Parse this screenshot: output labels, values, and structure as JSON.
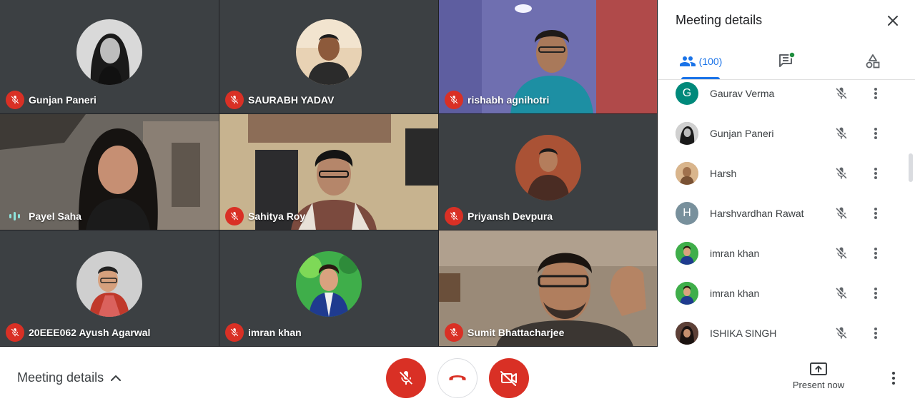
{
  "tiles": [
    {
      "name": "Gunjan Paneri",
      "mic": "muted"
    },
    {
      "name": "SAURABH YADAV",
      "mic": "muted"
    },
    {
      "name": "rishabh agnihotri",
      "mic": "muted"
    },
    {
      "name": "Payel Saha",
      "mic": "speaking"
    },
    {
      "name": "Sahitya Roy",
      "mic": "muted"
    },
    {
      "name": "Priyansh Devpura",
      "mic": "muted"
    },
    {
      "name": "20EEE062 Ayush Agarwal",
      "mic": "muted"
    },
    {
      "name": "imran khan",
      "mic": "muted"
    },
    {
      "name": "Sumit Bhattacharjee",
      "mic": "muted"
    }
  ],
  "panel": {
    "title": "Meeting details",
    "people_tab_label": "(100)",
    "chat_has_notification": true
  },
  "people": [
    {
      "name": "Gaurav Verma",
      "initial": "G",
      "avatar_color": "#00897b"
    },
    {
      "name": "Gunjan Paneri",
      "initial": "",
      "avatar_color": "#9e9e9e"
    },
    {
      "name": "Harsh",
      "initial": "",
      "avatar_color": "#c8a27a"
    },
    {
      "name": "Harshvardhan Rawat",
      "initial": "H",
      "avatar_color": "#78909c"
    },
    {
      "name": "imran khan",
      "initial": "",
      "avatar_color": "#4caf50"
    },
    {
      "name": "imran khan",
      "initial": "",
      "avatar_color": "#4caf50"
    },
    {
      "name": "ISHIKA SINGH",
      "initial": "",
      "avatar_color": "#3e2723"
    }
  ],
  "bottom": {
    "meeting_details_label": "Meeting details",
    "present_now_label": "Present now"
  },
  "colors": {
    "accent": "#1a73e8",
    "danger": "#d93025",
    "grid_bg": "#202124"
  }
}
